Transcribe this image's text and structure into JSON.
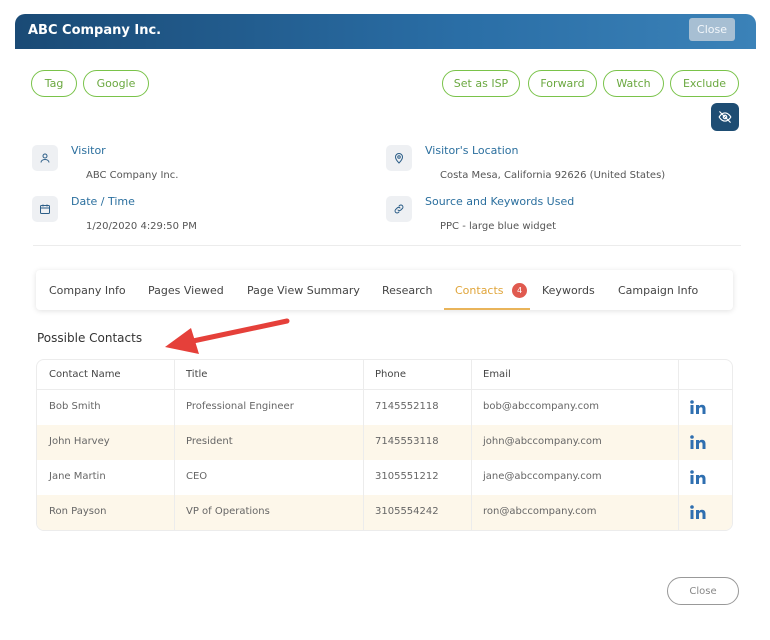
{
  "header": {
    "title": "ABC Company Inc.",
    "close_label": "Close"
  },
  "left_actions": [
    "Tag",
    "Google"
  ],
  "right_actions": [
    "Set as ISP",
    "Forward",
    "Watch",
    "Exclude"
  ],
  "info": {
    "visitor": {
      "label": "Visitor",
      "value": "ABC Company Inc."
    },
    "location": {
      "label": "Visitor's Location",
      "value": "Costa Mesa, California 92626 (United States)"
    },
    "datetime": {
      "label": "Date / Time",
      "value": "1/20/2020 4:29:50 PM"
    },
    "source": {
      "label": "Source and Keywords Used",
      "value": "PPC - large blue widget"
    }
  },
  "tabs": [
    "Company Info",
    "Pages Viewed",
    "Page View Summary",
    "Research",
    "Contacts",
    "Keywords",
    "Campaign Info"
  ],
  "active_tab": "Contacts",
  "contacts_badge": "4",
  "section_title": "Possible Contacts",
  "table": {
    "headers": [
      "Contact Name",
      "Title",
      "Phone",
      "Email"
    ],
    "rows": [
      [
        "Bob Smith",
        "Professional Engineer",
        "7145552118",
        "bob@abccompany.com"
      ],
      [
        "John Harvey",
        "President",
        "7145553118",
        "john@abccompany.com"
      ],
      [
        "Jane Martin",
        "CEO",
        "3105551212",
        "jane@abccompany.com"
      ],
      [
        "Ron Payson",
        "VP of Operations",
        "3105554242",
        "ron@abccompany.com"
      ]
    ]
  },
  "footer": {
    "close_label": "Close"
  },
  "colors": {
    "header": "#1a4a75",
    "green": "#7ac34a",
    "active_tab": "#e0a53a",
    "badge": "#e05a4f",
    "row_alt": "#fdf7ea",
    "link": "#2b6f9e"
  },
  "icons": {
    "visitor": "person-icon",
    "location": "location-pin-icon",
    "datetime": "calendar-icon",
    "source": "link-icon",
    "eye": "eye-slash-icon",
    "linkedin": "linkedin-icon"
  }
}
